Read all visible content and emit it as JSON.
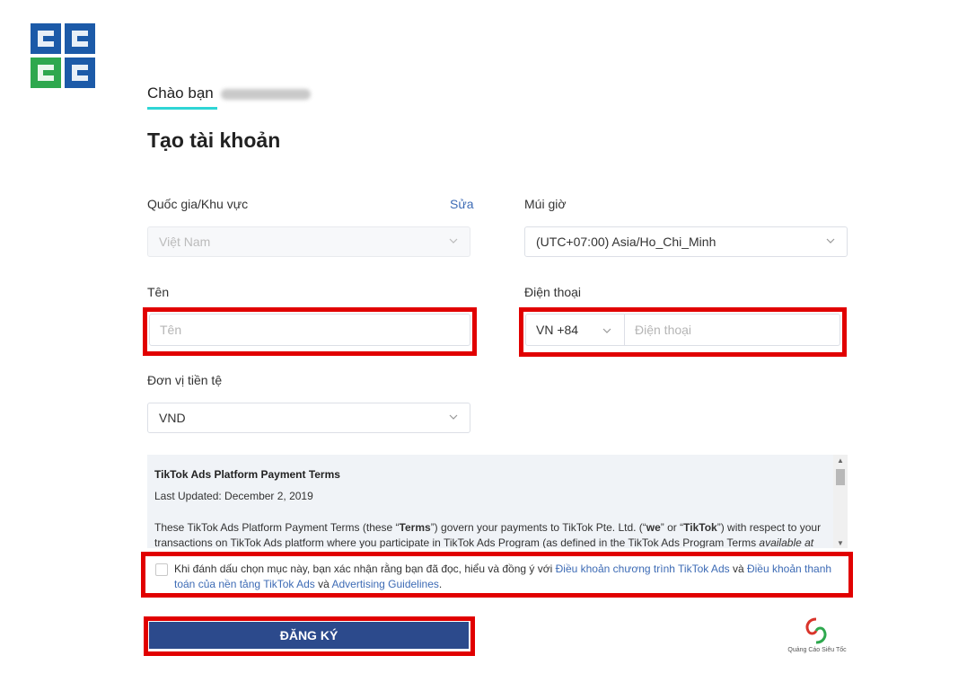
{
  "greeting": {
    "text": "Chào bạn"
  },
  "page_title": "Tạo tài khoản",
  "country": {
    "label": "Quốc gia/Khu vực",
    "edit_link": "Sửa",
    "value": "Việt Nam"
  },
  "timezone": {
    "label": "Múi giờ",
    "value": "(UTC+07:00) Asia/Ho_Chi_Minh"
  },
  "name": {
    "label": "Tên",
    "placeholder": "Tên"
  },
  "phone": {
    "label": "Điện thoại",
    "country_code": "VN +84",
    "placeholder": "Điện thoại"
  },
  "currency": {
    "label": "Đơn vị tiền tệ",
    "value": "VND"
  },
  "terms": {
    "title": "TikTok Ads Platform Payment Terms",
    "updated": "Last Updated: December 2, 2019",
    "body_1": "These TikTok Ads Platform Payment Terms (these “",
    "body_terms": "Terms",
    "body_2": "”) govern your payments to TikTok Pte. Ltd. (“",
    "body_we": "we",
    "body_3": "” or “",
    "body_tiktok": "TikTok",
    "body_4": "”) with respect to your transactions on TikTok Ads platform where you participate in TikTok Ads Program (as defined in the TikTok Ads Program Terms ",
    "body_italic": "available at"
  },
  "agreement": {
    "text_1": "Khi đánh dấu chọn mục này, bạn xác nhận rằng bạn đã đọc, hiểu và đồng ý với ",
    "link_1": "Điều khoản chương trình TikTok Ads",
    "and_1": " và ",
    "link_2": "Điều khoản thanh toán của nền tảng TikTok Ads",
    "and_2": " và ",
    "link_3": "Advertising Guidelines",
    "end": "."
  },
  "submit_label": "ĐĂNG KÝ",
  "watermark": {
    "text": "Quảng Cáo Siêu Tốc"
  },
  "colors": {
    "accent": "#2fd5d5",
    "button": "#2c4a8c",
    "link": "#3d6bb5",
    "highlight": "#e10000",
    "logo_blue": "#1c5aa8",
    "logo_green": "#2ea84e"
  }
}
